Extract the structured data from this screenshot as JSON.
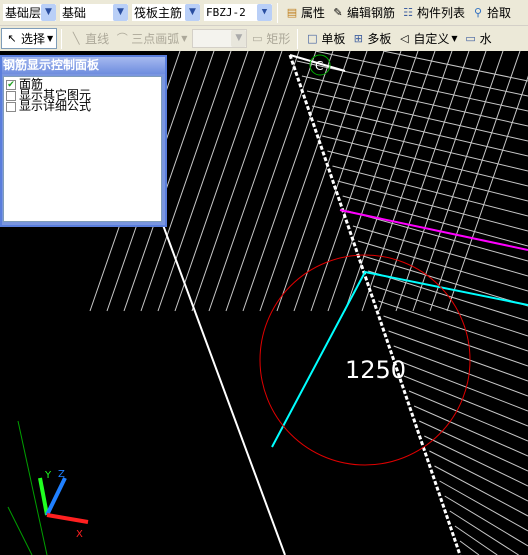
{
  "toolbar1": {
    "floor": "基础层",
    "category": "基础",
    "type": "筏板主筋",
    "name": "FBZJ-2",
    "buttons": [
      {
        "label": "属性",
        "icon": "properties-icon"
      },
      {
        "label": "编辑钢筋",
        "icon": "edit-rebar-icon"
      },
      {
        "label": "构件列表",
        "icon": "list-icon"
      },
      {
        "label": "拾取",
        "icon": "eyedropper-icon"
      }
    ]
  },
  "toolbar2": {
    "select": "选择",
    "line": "直线",
    "arc": "三点画弧",
    "rect": "矩形",
    "single": "单板",
    "multi": "多板",
    "custom": "自定义",
    "horiz": "水"
  },
  "panel": {
    "title": "钢筋显示控制面板",
    "options": [
      {
        "label": "面筋",
        "checked": true
      },
      {
        "label": "显示其它图元",
        "checked": false
      },
      {
        "label": "显示详细公式",
        "checked": false
      }
    ]
  },
  "canvas": {
    "dimension": "1250",
    "axis_label": "C",
    "axes": {
      "x": "X",
      "y": "Y",
      "z": "Z"
    },
    "colors": {
      "boundary": "#ffffff",
      "hatch": "#c8c8c8",
      "magenta": "#ff00ff",
      "cyan": "#00ffff",
      "circle": "#e00000",
      "axis_grid": "#00c000"
    }
  }
}
